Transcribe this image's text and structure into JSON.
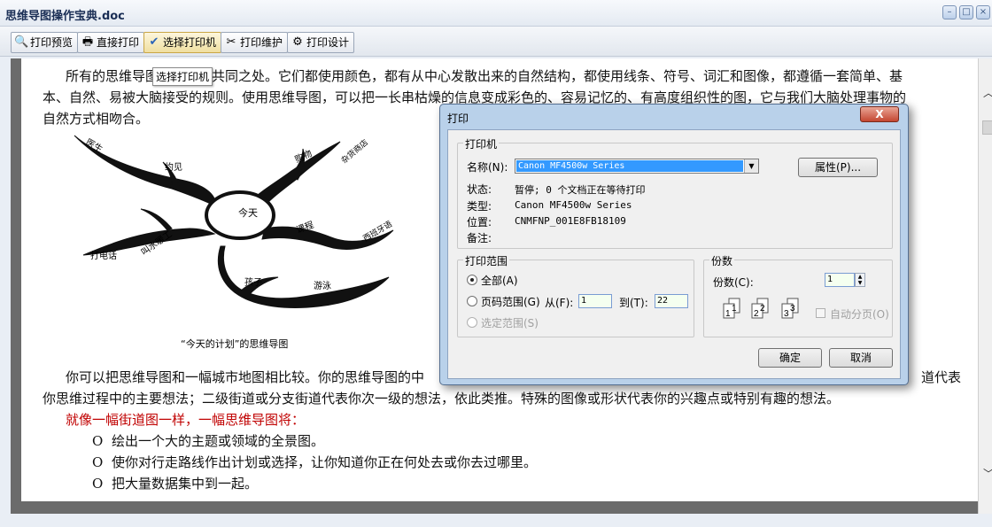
{
  "window": {
    "title": "思维导图操作宝典.doc"
  },
  "toolbar": {
    "buttons": [
      {
        "label": "打印预览",
        "icon": "print-preview-icon"
      },
      {
        "label": "直接打印",
        "icon": "printer-icon"
      },
      {
        "label": "选择打印机",
        "icon": "checkmark-icon"
      },
      {
        "label": "打印维护",
        "icon": "tools-icon"
      },
      {
        "label": "打印设计",
        "icon": "design-icon"
      }
    ],
    "tooltip": "选择打印机"
  },
  "document": {
    "para1_line1": "所有的思维导图都有一些共同之处。它们都使用颜色，都有从中心发散出来的自然结构，都使用线条、符号、词汇和图像，都遵循一套简单、基",
    "para1_line2": "本、自然、易被大脑接受的规则。使用思维导图，可以把一长串枯燥的信息变成彩色的、容易记忆的、有高度组织性的图，它与我们大脑处理事物的",
    "para1_line3": "自然方式相吻合。",
    "mindmap": {
      "center": "今天",
      "branches": [
        "医生",
        "约见",
        "购物",
        "杂货商店",
        "课程",
        "西班牙语",
        "孩子",
        "游泳",
        "叫水暖工",
        "打电话"
      ],
      "caption": "“今天的计划”的思维导图"
    },
    "para2_line1": "你可以把思维导图和一幅城市地图相比较。你的思维导图的中",
    "para2_line1_right": "道代表",
    "para2_line2": "你思维过程中的主要想法；二级街道或分支街道代表你次一级的想法，依此类推。特殊的图像或形状代表你的兴趣点或特别有趣的想法。",
    "red_line": "就像一幅街道图一样，一幅思维导图将：",
    "bullets": [
      "绘出一个大的主题或领域的全景图。",
      "使你对行走路线作出计划或选择，让你知道你正在何处去或你去过哪里。",
      "把大量数据集中到一起。"
    ],
    "bullet_symbol": "O"
  },
  "dialog": {
    "title": "打印",
    "close": "X",
    "printer_group": "打印机",
    "name_label": "名称(N):",
    "name_value": "Canon MF4500w Series",
    "properties_button": "属性(P)...",
    "status_label": "状态:",
    "status_value": "暂停; 0 个文档正在等待打印",
    "type_label": "类型:",
    "type_value": "Canon MF4500w Series",
    "location_label": "位置:",
    "location_value": "CNMFNP_001E8FB18109",
    "comment_label": "备注:",
    "range_group": "打印范围",
    "all_label": "全部(A)",
    "pages_label": "页码范围(G)",
    "from_label": "从(F):",
    "from_value": "1",
    "to_label": "到(T):",
    "to_value": "22",
    "selection_label": "选定范围(S)",
    "copies_group": "份数",
    "copies_label": "份数(C):",
    "copies_value": "1",
    "collate_label": "自动分页(O)",
    "ok_button": "确定",
    "cancel_button": "取消"
  }
}
